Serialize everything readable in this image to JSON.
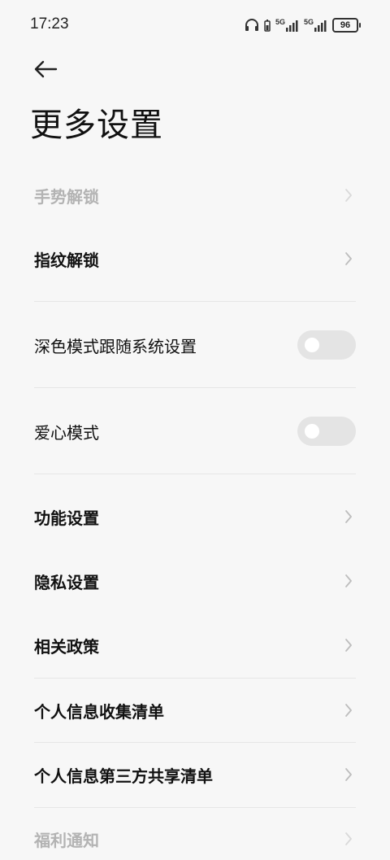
{
  "status_bar": {
    "time": "17:23",
    "signal1_label": "5G",
    "signal2_label": "5G",
    "battery_level": "96"
  },
  "header": {
    "title": "更多设置"
  },
  "items": [
    {
      "label": "手势解锁",
      "type": "link",
      "disabled": true
    },
    {
      "label": "指纹解锁",
      "type": "link"
    },
    {
      "label": "深色模式跟随系统设置",
      "type": "toggle",
      "on": false
    },
    {
      "label": "爱心模式",
      "type": "toggle",
      "on": false
    },
    {
      "label": "功能设置",
      "type": "link"
    },
    {
      "label": "隐私设置",
      "type": "link"
    },
    {
      "label": "相关政策",
      "type": "link"
    },
    {
      "label": "个人信息收集清单",
      "type": "link"
    },
    {
      "label": "个人信息第三方共享清单",
      "type": "link"
    },
    {
      "label": "福利通知",
      "type": "link",
      "disabled": true
    }
  ],
  "colors": {
    "background": "#f7f7f7",
    "text": "#111111",
    "disabled_text": "#b3b3b3",
    "toggle_off": "#e4e4e4",
    "chevron": "#bdbdbd"
  }
}
